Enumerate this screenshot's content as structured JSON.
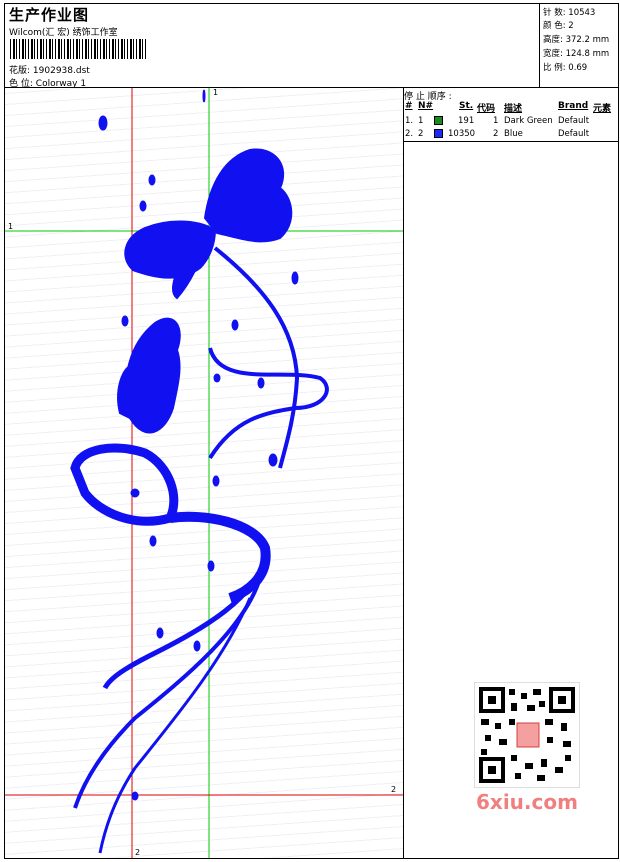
{
  "header": {
    "title": "生产作业图",
    "studio": "Wilcom(汇 宏) 绣饰工作室",
    "design_label": "花版:",
    "design_value": "1902938.dst",
    "color_label": "色 位:",
    "color_value": "Colorway 1"
  },
  "stats": [
    {
      "label": "针 数:",
      "value": "10543"
    },
    {
      "label": "颜 色:",
      "value": "2"
    },
    {
      "label": "高度:",
      "value": "372.2 mm"
    },
    {
      "label": "宽度:",
      "value": "124.8 mm"
    },
    {
      "label": "比 例:",
      "value": "0.69"
    }
  ],
  "stop_sequence": {
    "title": "停 止 顺序 :",
    "headers": [
      "#",
      "N#",
      "St.",
      "代码",
      "描述",
      "Brand",
      "元素"
    ],
    "rows": [
      {
        "num": "1.",
        "n": "1",
        "color": "#1a8a1a",
        "st": "191",
        "code": "1",
        "desc": "Dark Green",
        "brand": "Default"
      },
      {
        "num": "2.",
        "n": "2",
        "color": "#1a2aff",
        "st": "10350",
        "code": "2",
        "desc": "Blue",
        "brand": "Default"
      }
    ]
  },
  "axes": {
    "green_label": "1",
    "red_label": "2"
  },
  "colors": {
    "embroidery": "#1010f0",
    "green_guide": "#00c800",
    "red_guide": "#e00000"
  },
  "watermark": "6xiu.com",
  "icons": [
    "barcode",
    "qr-code"
  ]
}
